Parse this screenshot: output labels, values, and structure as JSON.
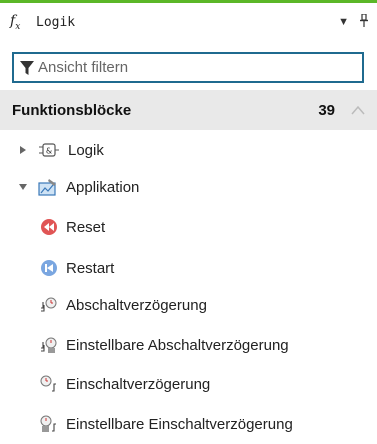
{
  "panel": {
    "fx_label": "f",
    "fx_sub": "x",
    "title": "Logik",
    "dropdown_icon": "▼",
    "pin_icon": "pin-icon"
  },
  "search": {
    "placeholder": "Ansicht filtern",
    "value": ""
  },
  "section": {
    "title": "Funktionsblöcke",
    "count": "39"
  },
  "tree": {
    "groups": [
      {
        "label": "Logik",
        "expanded": false,
        "icon": "logic-block-icon"
      },
      {
        "label": "Applikation",
        "expanded": true,
        "icon": "application-icon"
      }
    ],
    "items": [
      {
        "label": "Reset",
        "icon": "reset-icon",
        "color": "#e05555"
      },
      {
        "label": "Restart",
        "icon": "restart-icon",
        "color": "#5a8fd8"
      },
      {
        "label": "Abschaltverzögerung",
        "icon": "off-delay-icon"
      },
      {
        "label": "Einstellbare Abschaltverzögerung",
        "icon": "adjustable-off-delay-icon"
      },
      {
        "label": "Einschaltverzögerung",
        "icon": "on-delay-icon"
      },
      {
        "label": "Einstellbare Einschaltverzögerung",
        "icon": "adjustable-on-delay-icon"
      }
    ]
  },
  "colors": {
    "accent": "#5bb728",
    "search_border": "#1f6a8f",
    "section_bg": "#e9e9e9"
  }
}
